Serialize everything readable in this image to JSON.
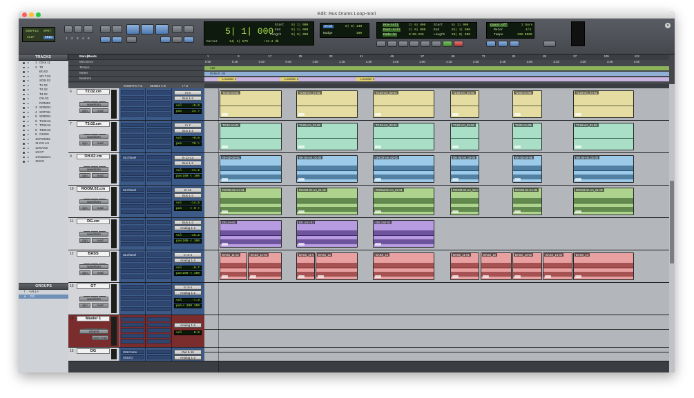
{
  "window": {
    "title": "Edit: Rus Drums Loop-mori"
  },
  "toolbar": {
    "shuffle_label": "SHUFFLE",
    "spot_label": "SPOT",
    "slip_label": "SLIP",
    "grid_label": "GRID",
    "zoom_presets": [
      "1",
      "2",
      "3",
      "4",
      "5"
    ],
    "main_counter": "5| 1| 000",
    "cursor_label": "Cursor",
    "cursor_value": "14| 3| 570",
    "dB_value": "+12.3 db",
    "start_label": "Start",
    "end_label": "End",
    "length_label": "Length",
    "start_value": "5| 1| 000",
    "end_value": "5| 1| 000",
    "length_value": "0| 0| 000",
    "grid_value": "0| 0| 240",
    "nudge_label": "Nudge",
    "nudge_value": "100",
    "preroll_label": "Pre-roll",
    "postroll_label": "Post-roll",
    "fadein_label": "Fade-in",
    "preroll_value": "2| 0| 000",
    "postroll_value": "2| 0| 000",
    "fadein_value": "0:00.250",
    "t_start_value": "5| 1| 000",
    "t_end_value": "61| 1| 000",
    "t_length_value": "56| 0| 000",
    "countoff_label": "Count Off",
    "countoff_value": "2 bars",
    "meter_label": "Meter",
    "meter_value": "4/4",
    "tempo_label": "Tempo",
    "tempo_value": "120.0000"
  },
  "tracks_panel": {
    "title": "TRACKS"
  },
  "groups_panel": {
    "title": "GROUPS"
  },
  "track_list": [
    {
      "num": "1",
      "name": "Click 11"
    },
    {
      "num": "2",
      "name": "T8"
    },
    {
      "num": "",
      "name": "B0.02"
    },
    {
      "num": "",
      "name": "SD T.02"
    },
    {
      "num": "",
      "name": "SDB.02"
    },
    {
      "num": "",
      "name": "T1.02"
    },
    {
      "num": "",
      "name": "T2.02"
    },
    {
      "num": "",
      "name": "T3.02"
    },
    {
      "num": "",
      "name": "OH.02"
    },
    {
      "num": "",
      "name": "ROM02"
    },
    {
      "num": "3",
      "name": "SDB02c"
    },
    {
      "num": "4",
      "name": "SDT02c"
    },
    {
      "num": "5",
      "name": "SDB02c"
    },
    {
      "num": "6",
      "name": "T102cm"
    },
    {
      "num": "7",
      "name": "T202cm"
    },
    {
      "num": "8",
      "name": "T302cm"
    },
    {
      "num": "9",
      "name": "OH02c"
    },
    {
      "num": "10",
      "name": "ROM02"
    },
    {
      "num": "11",
      "name": "DG.cm"
    },
    {
      "num": "12",
      "name": "BASS"
    },
    {
      "num": "13",
      "name": "GT"
    },
    {
      "num": "14",
      "name": "Master1"
    },
    {
      "num": "15",
      "name": "DG"
    }
  ],
  "groups": [
    {
      "id": "!",
      "name": "<ALL>"
    },
    {
      "id": "a",
      "name": "DG"
    }
  ],
  "rulers": {
    "bars_label": "Bars|Beats",
    "minsecs_label": "Min:Secs",
    "tempo_label": "Tempo",
    "meter_label": "Meter",
    "markers_label": "Markers",
    "bars": [
      "1",
      "9",
      "17",
      "25",
      "33",
      "41",
      "49",
      "57",
      "65",
      "73",
      "81",
      "89",
      "97",
      "105",
      "113"
    ],
    "mins": [
      "0:00",
      "0:15",
      "0:30",
      "0:45",
      "1:00",
      "1:15",
      "1:30",
      "1:45",
      "2:00",
      "2:15",
      "2:30",
      "2:45",
      "3:00",
      "3:15",
      "3:30",
      "3:45",
      "4:00"
    ],
    "tempo_value": "120",
    "meter_value": "Default: 4/4",
    "markers": [
      "Location 1",
      "Location 2",
      "Location 3"
    ]
  },
  "column_headers": {
    "inserts": "INSERTS A-E",
    "sends": "SENDS A-E",
    "io": "I / O"
  },
  "tracks": [
    {
      "num": "6",
      "name": "T2.02.cm",
      "view": "waveform",
      "dyn": "dyn",
      "read": "read",
      "insert": "",
      "in": "In 6",
      "out": "Bus 1-2",
      "vol": "+0.0",
      "pan": "24 >",
      "clipcolor": "#e4dca0",
      "wave": "#5c5a3a",
      "clips": [
        "T2.02-cm-01",
        "T2.02-cm_01-02",
        "T2.02-cm_02-01",
        "T2.02-cm_02-02",
        "T2.02-cm-05",
        "T2.02-cm_01-02"
      ]
    },
    {
      "num": "7",
      "name": "T3.02.cm",
      "view": "waveform",
      "dyn": "dyn",
      "read": "read",
      "insert": "",
      "in": "In 7",
      "out": "Bus 1-2",
      "vol": "+0.0",
      "pan": "70 >",
      "clipcolor": "#a9dfc7",
      "wave": "#335a4b",
      "clips": [
        "T3.02-cm-01",
        "T3.02-cm_01-02",
        "T3.02-cm_02-01",
        "T3.02-cm_02-02",
        "T3.02-cm-05",
        "T3.02-cm_01-02"
      ]
    },
    {
      "num": "9",
      "name": "OH.02.cm",
      "view": "waveform",
      "dyn": "dyn",
      "read": "read",
      "insert": "SLChanel",
      "in": "In 11-12",
      "out": "Bus 1-2",
      "vol": "-11.2",
      "pan": "100 < 100",
      "clipcolor": "#9ccae8",
      "wave": "#1f4f74",
      "clips": [
        "OH.02-cm-01",
        "OH.02-cm_01-02",
        "OH.02-cm_02-01",
        "OH.02-cm_02-02",
        "OH.02-cm-05",
        "OH.02-cm_01-02"
      ]
    },
    {
      "num": "10",
      "name": "ROOM.02.cm",
      "view": "waveform",
      "dyn": "dyn",
      "read": "read",
      "insert": "SLChanel",
      "in": "In 13",
      "out": "Bus 1-2",
      "vol": "-14.6",
      "pan": "< 0 >",
      "clipcolor": "#aed38e",
      "wave": "#2f5a23",
      "clips": [
        "ROOM.02-cm-01",
        "ROOM.02-cm_01-02",
        "ROOM.02-cm_02-01",
        "ROOM.02-cm_02-02",
        "ROOM.02-cm-05",
        "ROOM.02-cm_01-02"
      ]
    },
    {
      "num": "11",
      "name": "DG.cm",
      "view": "waveform",
      "dyn": "dyn",
      "read": "read",
      "insert": "",
      "in": "Bus 1-2",
      "out": "Analog 1-2",
      "vol": "-15.2",
      "pan": "100 < 100",
      "clipcolor": "#b79be0",
      "wave": "#3e2370",
      "clips": [
        "DG.cm-01",
        "DG.cm1-01",
        "DG.cm2-01"
      ]
    },
    {
      "num": "12",
      "name": "BASS",
      "view": "waveform",
      "dyn": "dyn",
      "read": "read",
      "insert": "SLChanel",
      "in": "In 3-4",
      "out": "Analog 1-2",
      "vol": "-0.7",
      "pan": "100 < 100",
      "clipcolor": "#e8a0a0",
      "wave": "#7a1e1e",
      "clips": [
        "BASS_11-01",
        "BASS_11-02",
        "BASS_11-01",
        "BASS_12",
        "BASS_13",
        "BASS_11-01",
        "BASS_12",
        "BASS_13-02",
        "BASS_14-02",
        "BASS_13"
      ]
    },
    {
      "num": "13",
      "name": "GT",
      "view": "waveform",
      "dyn": "dyn",
      "read": "read",
      "insert": "",
      "in": "In 3-4",
      "out": "Analog 1-2",
      "vol": "-7.9",
      "pan": "< 100 100",
      "clipcolor": "#cccccc",
      "wave": "#555555",
      "clips": []
    },
    {
      "num": "14",
      "name": "Master 1",
      "view": "volume",
      "dyn": "",
      "read": "auto read",
      "insert": "",
      "in": "",
      "out": "Analog 1-2",
      "vol": "0.0",
      "pan": "",
      "clipcolor": "#cccccc",
      "wave": "#333333",
      "clips": []
    },
    {
      "num": "15",
      "name": "DG",
      "view": "",
      "dyn": "",
      "read": "",
      "insert": "SSLComp",
      "insert2": "SSLEQ",
      "in": "Out 9-10",
      "out": "Bus 1-2",
      "out2": "Analog 1-2",
      "vol": "",
      "pan": "",
      "clipcolor": "#cccccc",
      "wave": "#333333",
      "clips": []
    }
  ]
}
